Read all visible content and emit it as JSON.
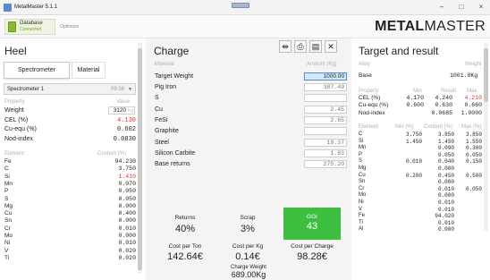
{
  "window": {
    "title": "MetalMaster 5.1.1",
    "minimize": "–",
    "maximize": "□",
    "close": "×"
  },
  "toolbar": {
    "db_label": "Database",
    "db_status": "Connected",
    "optimizer": "Optimizer",
    "brand_bold": "METAL",
    "brand_light": "MASTER"
  },
  "heel": {
    "title": "Heel",
    "tabs": [
      "Spectrometer",
      "Material"
    ],
    "select_value": "Spectrometer 1",
    "select_time": "09:39",
    "prop_headers": [
      "Property",
      "Value"
    ],
    "props": [
      {
        "name": "Weight",
        "value": "3120",
        "unit": "Kg",
        "color": "#222"
      },
      {
        "name": "CEL (%)",
        "value": "4.130",
        "color": "#e0332b"
      },
      {
        "name": "Cu-equ (%)",
        "value": "0.602",
        "color": "#222"
      },
      {
        "name": "Nod-index",
        "value": "0.0830",
        "color": "#222"
      }
    ],
    "elem_headers": [
      "Element",
      "Content (%)"
    ],
    "elements": [
      {
        "name": "Fe",
        "value": "94.230",
        "color": "#222"
      },
      {
        "name": "C",
        "value": "3.750",
        "color": "#222"
      },
      {
        "name": "Si",
        "value": "1.410",
        "color": "#e0332b"
      },
      {
        "name": "Mn",
        "value": "0.070",
        "color": "#222"
      },
      {
        "name": "P",
        "value": "0.050",
        "color": "#222"
      },
      {
        "name": "S",
        "value": "0.050",
        "color": "#222"
      },
      {
        "name": "Mg",
        "value": "0.000",
        "color": "#222"
      },
      {
        "name": "Cu",
        "value": "0.400",
        "color": "#222"
      },
      {
        "name": "Sn",
        "value": "0.000",
        "color": "#222"
      },
      {
        "name": "Cr",
        "value": "0.010",
        "color": "#222"
      },
      {
        "name": "Mo",
        "value": "0.000",
        "color": "#222"
      },
      {
        "name": "Ni",
        "value": "0.010",
        "color": "#222"
      },
      {
        "name": "V",
        "value": "0.020",
        "color": "#222"
      },
      {
        "name": "Ti",
        "value": "0.020",
        "color": "#222"
      }
    ]
  },
  "charge": {
    "title": "Charge",
    "headers": [
      "Material",
      "Amount (Kg)"
    ],
    "target_label": "Target Weight",
    "target_value": "1000.00",
    "materials": [
      {
        "name": "Pig Iron",
        "value": "387.49"
      },
      {
        "name": "S",
        "value": ""
      },
      {
        "name": "Cu",
        "value": "2.45"
      },
      {
        "name": "FeSi",
        "value": "2.65"
      },
      {
        "name": "Graphite",
        "value": ""
      },
      {
        "name": "Steel",
        "value": "19.37"
      },
      {
        "name": "Silicon Carbite",
        "value": "1.83"
      },
      {
        "name": "Base returns",
        "value": "275.20"
      }
    ],
    "returns_label": "Returns",
    "returns_value": "40%",
    "scrap_label": "Scrap",
    "scrap_value": "3%",
    "ggi_label": "GGI",
    "ggi_value": "43",
    "cost_ton_label": "Cost per Ton",
    "cost_ton_value": "142.64€",
    "cost_kg_label": "Cost per Kg",
    "cost_kg_value": "0.14€",
    "cost_charge_label": "Cost per Charge",
    "cost_charge_value": "98.28€",
    "charge_weight_label": "Charge Weight",
    "charge_weight_value": "689.00Kg",
    "icons": [
      "split-icon",
      "print-icon",
      "document-icon",
      "close-icon"
    ]
  },
  "target": {
    "title": "Target and result",
    "alloy_headers": [
      "Alloy",
      "Weight"
    ],
    "alloy_name": "Base",
    "alloy_weight": "1001.0Kg",
    "prop_headers": [
      "Property",
      "Min",
      "Result",
      "Max"
    ],
    "props": [
      {
        "name": "CEL (%)",
        "min": "4.170",
        "result": "4.240",
        "max": "4.210",
        "max_color": "#e0332b"
      },
      {
        "name": "Cu-equ (%)",
        "min": "0.600",
        "result": "0.630",
        "max": "0.660",
        "max_color": "#222"
      },
      {
        "name": "Nod-index",
        "min": "",
        "result": "0.0685",
        "max": "1.0000",
        "max_color": "#222"
      }
    ],
    "elem_headers": [
      "Element",
      "Min (%)",
      "Content (%)",
      "Max (%)"
    ],
    "elements": [
      {
        "name": "C",
        "min": "3.750",
        "content": "3.850",
        "max": "3.850"
      },
      {
        "name": "Si",
        "min": "1.450",
        "content": "1.450",
        "max": "1.550"
      },
      {
        "name": "Mn",
        "min": "",
        "content": "0.090",
        "max": "0.300"
      },
      {
        "name": "P",
        "min": "",
        "content": "0.050",
        "max": "0.050"
      },
      {
        "name": "S",
        "min": "0.010",
        "content": "0.040",
        "max": "0.150"
      },
      {
        "name": "Mg",
        "min": "",
        "content": "0.000",
        "max": ""
      },
      {
        "name": "Cu",
        "min": "0.200",
        "content": "0.450",
        "max": "0.500"
      },
      {
        "name": "Sn",
        "min": "",
        "content": "0.000",
        "max": ""
      },
      {
        "name": "Cr",
        "min": "",
        "content": "0.010",
        "max": "0.050"
      },
      {
        "name": "Mo",
        "min": "",
        "content": "0.000",
        "max": ""
      },
      {
        "name": "Ni",
        "min": "",
        "content": "0.010",
        "max": ""
      },
      {
        "name": "V",
        "min": "",
        "content": "0.010",
        "max": ""
      },
      {
        "name": "Fe",
        "min": "",
        "content": "94.020",
        "max": ""
      },
      {
        "name": "Ti",
        "min": "",
        "content": "0.010",
        "max": ""
      },
      {
        "name": "Al",
        "min": "",
        "content": "0.000",
        "max": ""
      }
    ]
  }
}
